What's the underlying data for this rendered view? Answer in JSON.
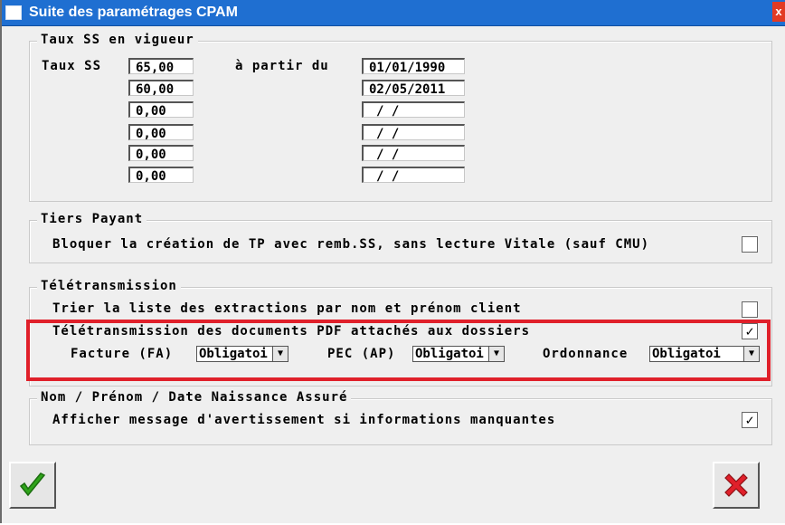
{
  "window": {
    "title": "Suite des paramétrages CPAM",
    "close_label": "x"
  },
  "taux": {
    "legend": "Taux SS en vigueur",
    "label": "Taux SS",
    "date_label": "à partir du",
    "rates": [
      "65,00",
      "60,00",
      "0,00",
      "0,00",
      "0,00",
      "0,00"
    ],
    "dates": [
      "01/01/1990",
      "02/05/2011",
      " / /",
      " / /",
      " / /",
      " / /"
    ]
  },
  "tiers_payant": {
    "legend": "Tiers Payant",
    "option_label": "Bloquer la création de TP avec remb.SS, sans lecture Vitale (sauf CMU)",
    "checked": false
  },
  "teletransmission": {
    "legend": "Télétransmission",
    "sort_label": "Trier la liste des extractions par nom et prénom client",
    "sort_checked": false,
    "pdf_label": "Télétransmission des documents PDF attachés aux dossiers",
    "pdf_checked": true,
    "pdf_check_mark": "✓",
    "facture_label": "Facture (FA)",
    "facture_value": "Obligatoi",
    "pec_label": "PEC (AP)",
    "pec_value": "Obligatoi",
    "ordonnance_label": "Ordonnance",
    "ordonnance_value": "Obligatoi"
  },
  "assure": {
    "legend": "Nom / Prénom / Date Naissance Assuré",
    "warning_label": "Afficher message d'avertissement si informations manquantes",
    "warning_checked": true,
    "warning_check_mark": "✓"
  },
  "buttons": {
    "ok_icon": "check-icon",
    "cancel_icon": "cross-icon"
  },
  "colors": {
    "titlebar": "#1f6fd1",
    "highlight": "#e0202a",
    "ok": "#2fa51b",
    "cancel": "#e0202a"
  }
}
